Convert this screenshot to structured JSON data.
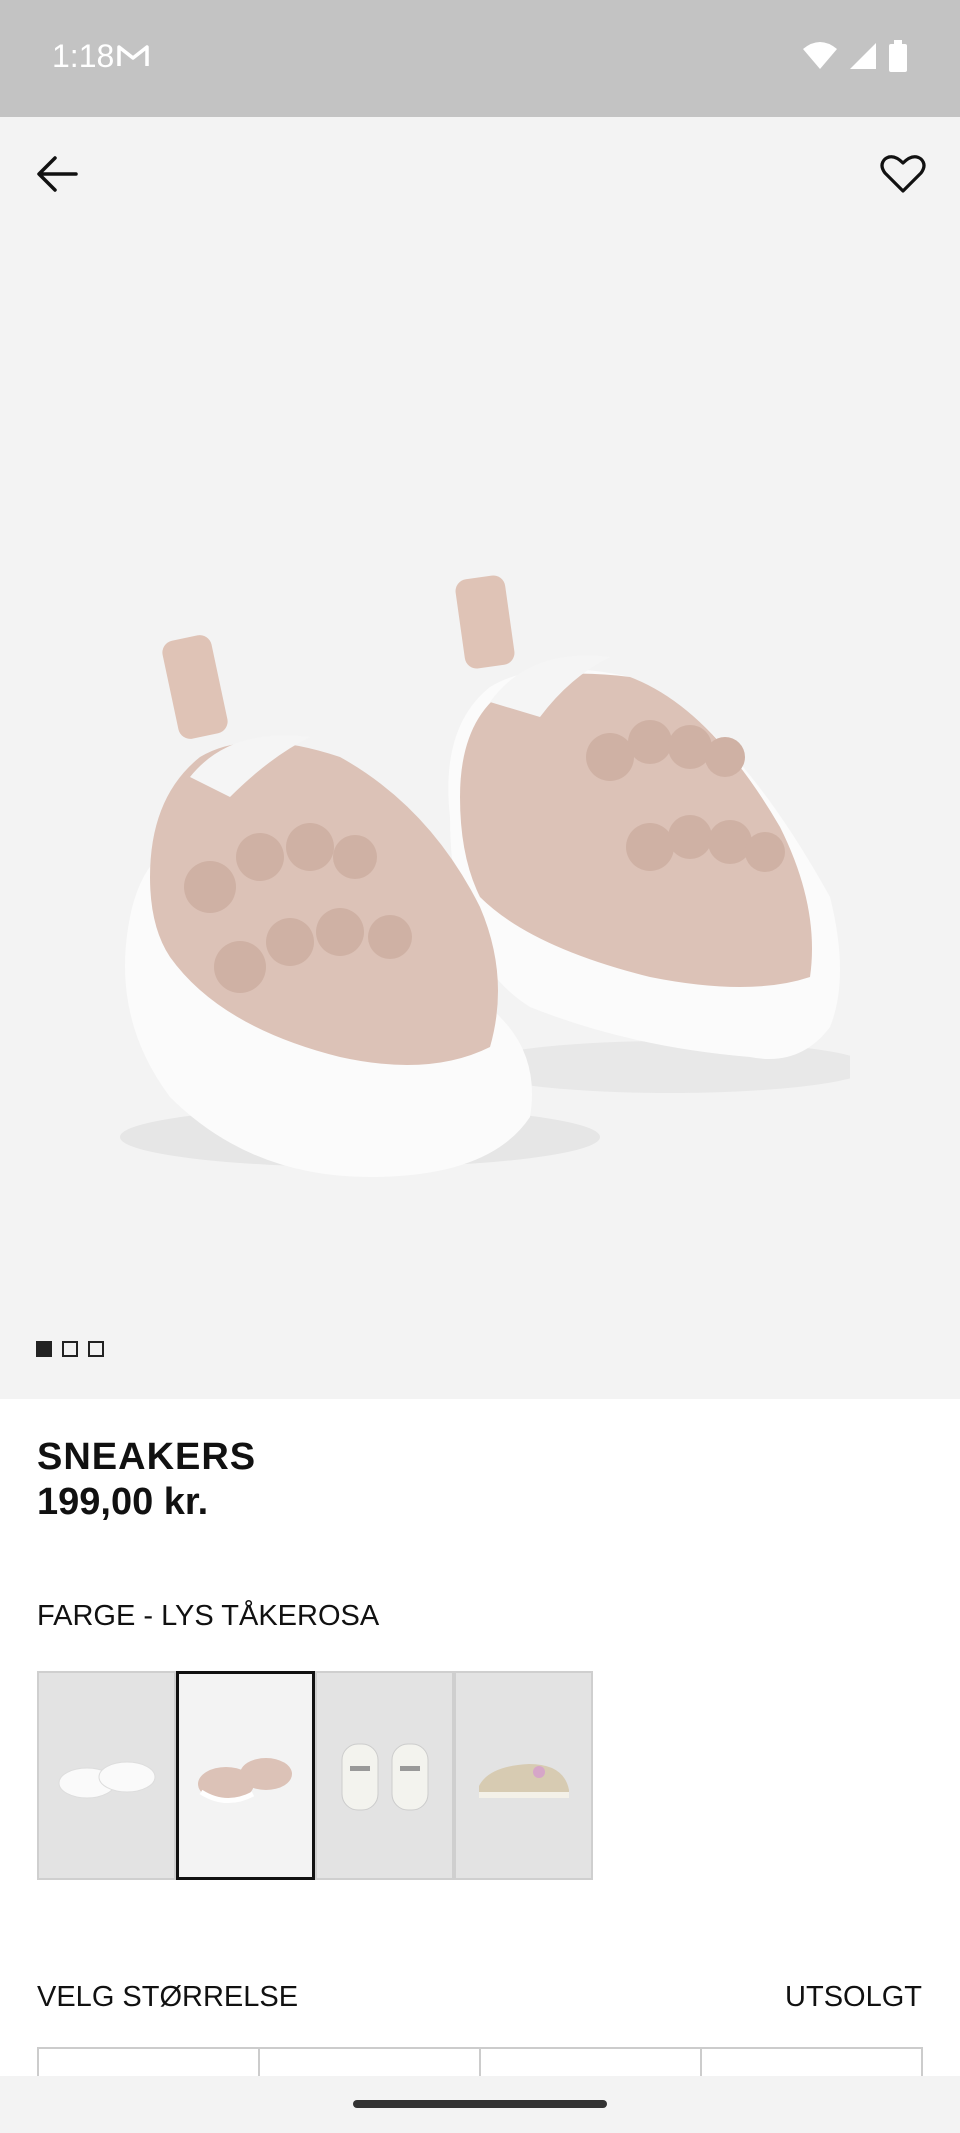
{
  "status_bar": {
    "time": "1:18",
    "icons": [
      "gmail-icon",
      "wifi-icon",
      "signal-icon",
      "battery-icon"
    ]
  },
  "header": {
    "back_icon": "arrow-left-icon",
    "favorite_icon": "heart-outline-icon"
  },
  "gallery": {
    "image_count": 3,
    "active_index": 0
  },
  "product": {
    "title": "SNEAKERS",
    "price": "199,00 kr."
  },
  "color": {
    "label": "FARGE - LYS TÅKEROSA",
    "options_count": 4,
    "selected_index": 1
  },
  "size": {
    "label": "VELG STØRRELSE",
    "status": "UTSOLGT"
  },
  "colors": {
    "status_bar_bg": "#c3c3c3",
    "hero_bg": "#f3f3f3",
    "text": "#111111"
  }
}
